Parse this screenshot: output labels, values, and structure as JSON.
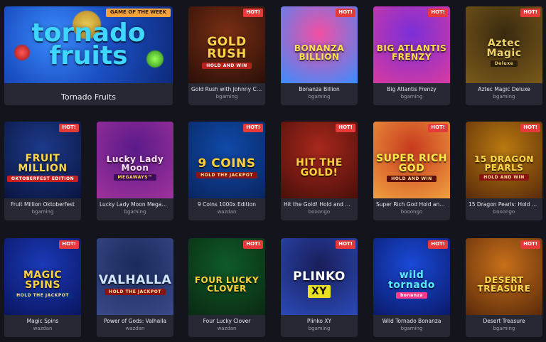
{
  "featured": {
    "badge": "GAME OF THE WEEK",
    "logo_line1": "tornado",
    "logo_line2": "fruits",
    "title": "Tornado Fruits",
    "colors": {
      "bg": "#1b4fc4",
      "logo": "#3fd7ff"
    }
  },
  "rows": [
    [
      {
        "title": "Gold Rush with Johnny Cash",
        "provider": "bgaming",
        "badge": "HOT!",
        "logo": "GOLD RUSH",
        "sub": "HOLD AND WIN",
        "bg1": "#7a2f14",
        "bg2": "#2a0f08",
        "fg": "#ffd24a",
        "sub_bg": "#b8201c",
        "sub_fg": "#ffffff"
      },
      {
        "title": "Bonanza Billion",
        "provider": "bgaming",
        "badge": "HOT!",
        "logo": "BONANZA BILLION",
        "sub": "",
        "bg1": "#f24fa3",
        "bg2": "#3a8cff",
        "fg": "#ffe14d",
        "sub_bg": "",
        "sub_fg": ""
      },
      {
        "title": "Big Atlantis Frenzy",
        "provider": "bgaming",
        "badge": "HOT!",
        "logo": "BIG ATLANTIS FRENZY",
        "sub": "",
        "bg1": "#7a2fd8",
        "bg2": "#d83aa0",
        "fg": "#ffe04a",
        "sub_bg": "",
        "sub_fg": ""
      },
      {
        "title": "Aztec Magic Deluxe",
        "provider": "bgaming",
        "badge": "HOT!",
        "logo": "Aztec Magic",
        "sub": "Deluxe",
        "bg1": "#3a2a10",
        "bg2": "#7a5a1a",
        "fg": "#f0d26a",
        "sub_bg": "#2b1e0a",
        "sub_fg": "#f0d26a"
      }
    ],
    [
      {
        "title": "Fruit Million Oktoberfest",
        "provider": "bgaming",
        "badge": "HOT!",
        "logo": "FRUIT MILLION",
        "sub": "OKTOBERFEST EDITION",
        "bg1": "#1c3a8a",
        "bg2": "#0a1540",
        "fg": "#ffd84a",
        "sub_bg": "#c81e1e",
        "sub_fg": "#ffffff"
      },
      {
        "title": "Lucky Lady Moon Megaways",
        "provider": "bgaming",
        "badge": "",
        "logo": "Lucky Lady Moon",
        "sub": "MEGAWAYS™",
        "bg1": "#5a1a8a",
        "bg2": "#a0329a",
        "fg": "#ffe0f4",
        "sub_bg": "#3b0d5a",
        "sub_fg": "#ffd84a"
      },
      {
        "title": "9 Coins 1000x Edition",
        "provider": "wazdan",
        "badge": "HOT!",
        "logo": "9 COINS",
        "sub": "HOLD THE JACKPOT",
        "bg1": "#0f4aa8",
        "bg2": "#0a2560",
        "fg": "#ffcf3a",
        "sub_bg": "#8a1414",
        "sub_fg": "#ffe39a"
      },
      {
        "title": "Hit the Gold! Hold and Win",
        "provider": "booongo",
        "badge": "HOT!",
        "logo": "HIT THE GOLD!",
        "sub": "",
        "bg1": "#a8281c",
        "bg2": "#4a0f0a",
        "fg": "#ffd23a",
        "sub_bg": "",
        "sub_fg": ""
      },
      {
        "title": "Super Rich God Hold and ...",
        "provider": "booongo",
        "badge": "HOT!",
        "logo": "SUPER RICH GOD",
        "sub": "HOLD AND WIN",
        "bg1": "#c83a1e",
        "bg2": "#f0a040",
        "fg": "#ffe84a",
        "sub_bg": "#5a0e0a",
        "sub_fg": "#ffe39a"
      },
      {
        "title": "15 Dragon Pearls: Hold and ...",
        "provider": "booongo",
        "badge": "HOT!",
        "logo": "15 DRAGON PEARLS",
        "sub": "HOLD AND WIN",
        "bg1": "#b87a10",
        "bg2": "#5a2a0a",
        "fg": "#ffd84a",
        "sub_bg": "#8a1414",
        "sub_fg": "#ffe39a"
      }
    ],
    [
      {
        "title": "Magic Spins",
        "provider": "wazdan",
        "badge": "HOT!",
        "logo": "MAGIC SPINS",
        "sub": "HOLD THE JACKPOT",
        "bg1": "#1a3ab8",
        "bg2": "#0a1560",
        "fg": "#ffd23a",
        "sub_bg": "#0a2a80",
        "sub_fg": "#ffe39a"
      },
      {
        "title": "Power of Gods: Valhalla",
        "provider": "wazdan",
        "badge": "",
        "logo": "VALHALLA",
        "sub": "HOLD THE JACKPOT",
        "bg1": "#1a2a5a",
        "bg2": "#3a4a8a",
        "fg": "#cfe6ff",
        "sub_bg": "#8a1414",
        "sub_fg": "#ffe39a"
      },
      {
        "title": "Four Lucky Clover",
        "provider": "wazdan",
        "badge": "HOT!",
        "logo": "FOUR LUCKY CLOVER",
        "sub": "",
        "bg1": "#0f5a2a",
        "bg2": "#0a2a12",
        "fg": "#ffd23a",
        "sub_bg": "",
        "sub_fg": ""
      },
      {
        "title": "Plinko XY",
        "provider": "bgaming",
        "badge": "HOT!",
        "logo": "PLINKO",
        "sub": "XY",
        "bg1": "#1a1e5a",
        "bg2": "#2a4ab8",
        "fg": "#ffffff",
        "sub_bg": "#e8e020",
        "sub_fg": "#111111"
      },
      {
        "title": "Wild Tornado Bonanza",
        "provider": "bgaming",
        "badge": "HOT!",
        "logo": "wild tornado",
        "sub": "bonanza",
        "bg1": "#1a4ad8",
        "bg2": "#0a1a6a",
        "fg": "#5ae8ff",
        "sub_bg": "#ff3a8a",
        "sub_fg": "#ffffff"
      },
      {
        "title": "Desert Treasure",
        "provider": "bgaming",
        "badge": "HOT!",
        "logo": "DESERT TREASURE",
        "sub": "",
        "bg1": "#c8701a",
        "bg2": "#5a2a0a",
        "fg": "#ffd84a",
        "sub_bg": "",
        "sub_fg": ""
      }
    ]
  ]
}
